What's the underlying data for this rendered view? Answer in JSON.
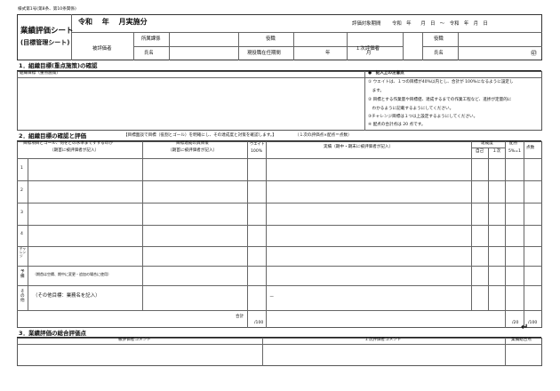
{
  "form_label": "様式第1号(第8条、第10条関係)",
  "header": {
    "title_line1": "業績評価シート",
    "title_line2": "(目標管理シート)",
    "year_title": "令和　 年　 月実施分",
    "period_label": "評価対象期間",
    "period_value": "令和　年　　月　日　～　令和　年　月　日",
    "evaluatee_label": "被評価者",
    "dept_label": "所属課係",
    "position_label": "役職",
    "name_label": "氏名",
    "tenure_label": "現役職在任期間",
    "year_unit": "年",
    "month_unit": "月",
    "first_evaluator_label": "１次評価者",
    "fe_position_label": "役職",
    "fe_name_label": "氏名",
    "seal": "㊞"
  },
  "section1": {
    "heading": "1．組織目標(重点施策)の確認",
    "sub_label": "組織目標（重点施策）",
    "notes_title": "●　記入上の注意点",
    "notes": [
      "① ウエイトは、１つの目標が40%以内とし、合計が 100%になるように設定し",
      "　ます。",
      "② 目標とする作業量や目標値、達成するまでの作業工程など、進捗が定量的に",
      "　わかるように記載するようにしてください。",
      "③チャレンジ目標は１つ以上設定するようにしてください。",
      "④ 配点の合計点は 20 点です。"
    ]
  },
  "section2": {
    "heading": "2．組織目標の確認と評価",
    "heading_note": "【目標面談で目標（役割とゴール）を明確にし、その達成度と対策を確認します。】",
    "score_note": "（１次の評価点×配点＝点数）",
    "col_goal": "目標項目とゴール、何をどの水準まですするのか",
    "col_goal_sub": "（期首に被評価者が記入）",
    "col_method": "目標達成の具体策",
    "col_method_sub": "（期首に被評価者が記入）",
    "col_weight": "ウエイト",
    "col_weight_total": "100%",
    "col_result": "実績（期中・期末に被評価者が記入）",
    "col_achievement": "達成度",
    "col_self": "自己",
    "col_first": "１次",
    "col_points": "配点",
    "col_points_sub": "5%=1",
    "col_score": "点数",
    "rows": [
      "1",
      "2",
      "3",
      "4"
    ],
    "challenge_label": "チャレンジ",
    "plan_label": "予備",
    "plan_note": "（期首は空欄、期中に変更・追加の場合に使用）",
    "other_label": "その他",
    "other_text": "（その他目標：業務名を記入）",
    "other_mark": "－",
    "total_label": "合計",
    "total_weight": "/100",
    "total_points": "/20",
    "total_score": "/100"
  },
  "section3": {
    "heading": "3．業績評価の総合評価点",
    "col_evaluatee_comment": "被評価者コメント",
    "col_first_comment": "１次評価者コメント",
    "col_total_score": "業績総合点"
  },
  "return_symbol": "↵"
}
